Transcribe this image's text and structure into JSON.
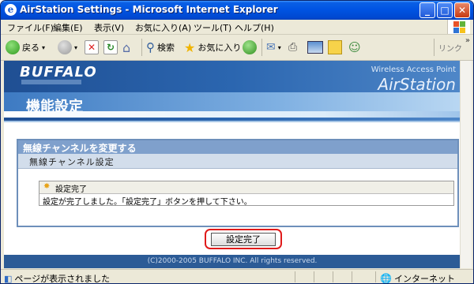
{
  "window": {
    "title": "AirStation Settings - Microsoft Internet Explorer",
    "minimize": "_",
    "maximize": "□",
    "close": "✕"
  },
  "menu": [
    "ファイル(F)",
    "編集(E)",
    "表示(V)",
    "お気に入り(A)",
    "ツール(T)",
    "ヘルプ(H)"
  ],
  "toolbar": {
    "back": "戻る",
    "search": "検索",
    "favorites": "お気に入り",
    "links": "リンク",
    "overflow": "»"
  },
  "header": {
    "brand": "BUFFALO",
    "product_tag": "Wireless Access Point",
    "product_name": "AirStation",
    "page_title": "機能設定"
  },
  "section": {
    "title": "無線チャンネルを変更する",
    "subtitle": "無線チャンネル設定"
  },
  "message": {
    "heading": "設定完了",
    "body": "設定が完了しました。「設定完了」ボタンを押して下さい。"
  },
  "button": {
    "label": "設定完了"
  },
  "footer": {
    "copyright": "(C)2000-2005 BUFFALO INC. All rights reserved."
  },
  "status": {
    "left": "ページが表示されました",
    "zone": "インターネット"
  },
  "colors": {
    "title_bar": "#0054e3",
    "header_blue": "#2b66b0",
    "section_border": "#6d8fba",
    "highlight_ring": "#e01b1b"
  }
}
